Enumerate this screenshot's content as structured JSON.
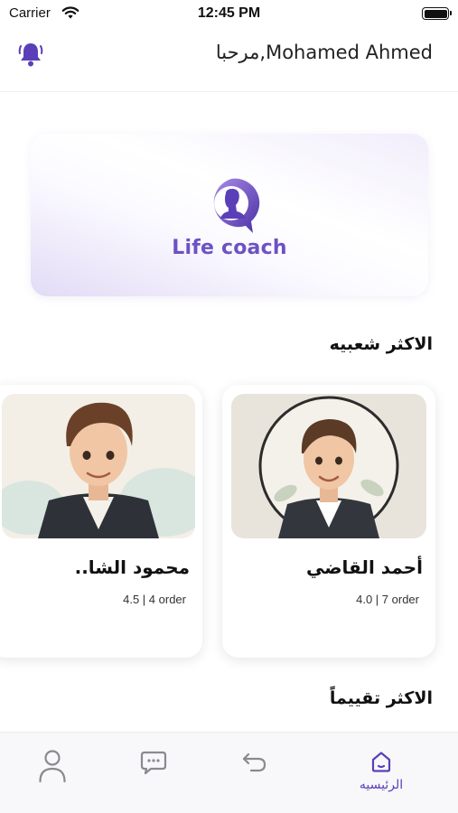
{
  "status_bar": {
    "carrier": "Carrier",
    "time": "12:45 PM"
  },
  "header": {
    "greeting": "مرحبا,Mohamed Ahmed"
  },
  "banner": {
    "logo_text": "Life coach"
  },
  "sections": {
    "popular_title": "الاكثر شعبيه",
    "top_rated_title": "الاكثر تقييماً"
  },
  "coaches": [
    {
      "name": "أحمد القاضي",
      "meta": "4.0 | 7 order"
    },
    {
      "name": "محمود الشا..",
      "meta": "4.5 | 4 order"
    }
  ],
  "tabbar": {
    "home_label": "الرئيسيه"
  },
  "colors": {
    "accent": "#5a3fb8",
    "accent_light": "#8f7ad8"
  },
  "icons": [
    "bell-icon",
    "wifi-icon",
    "battery-icon",
    "home-icon",
    "back-arrow-icon",
    "chat-icon",
    "profile-icon"
  ]
}
